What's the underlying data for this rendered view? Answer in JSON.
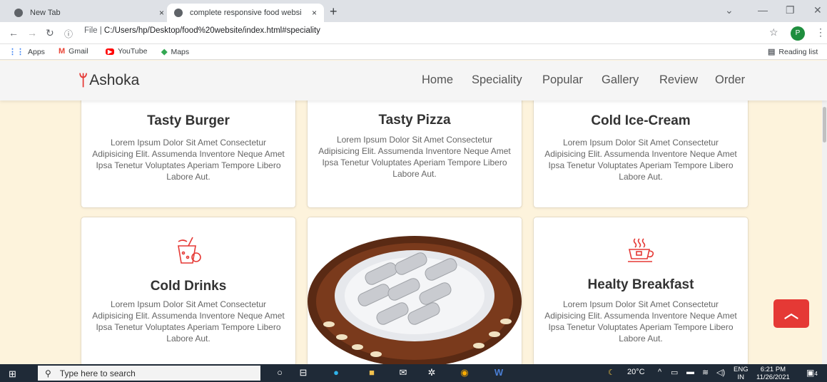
{
  "browser": {
    "tabs": [
      {
        "title": "New Tab",
        "close": "×"
      },
      {
        "title": "complete responsive food websi",
        "close": "×"
      }
    ],
    "new_tab": "+",
    "url_prefix": "File",
    "url": "C:/Users/hp/Desktop/food%20website/index.html#speciality",
    "profile_initial": "P",
    "bookmarks": [
      "Apps",
      "Gmail",
      "YouTube",
      "Maps"
    ],
    "reading_list": "Reading list"
  },
  "site": {
    "logo": "Ashoka",
    "nav": [
      "Home",
      "Speciality",
      "Popular",
      "Gallery",
      "Review",
      "Order"
    ]
  },
  "cards": [
    {
      "title": "Tasty Burger",
      "text": "Lorem Ipsum Dolor Sit Amet Consectetur Adipisicing Elit. Assumenda Inventore Neque Amet Ipsa Tenetur Voluptates Aperiam Tempore Libero Labore Aut."
    },
    {
      "title": "Tasty Pizza",
      "text": "Lorem Ipsum Dolor Sit Amet Consectetur Adipisicing Elit. Assumenda Inventore Neque Amet Ipsa Tenetur Voluptates Aperiam Tempore Libero Labore Aut."
    },
    {
      "title": "Cold Ice-Cream",
      "text": "Lorem Ipsum Dolor Sit Amet Consectetur Adipisicing Elit. Assumenda Inventore Neque Amet Ipsa Tenetur Voluptates Aperiam Tempore Libero Labore Aut."
    },
    {
      "title": "Cold Drinks",
      "text": "Lorem Ipsum Dolor Sit Amet Consectetur Adipisicing Elit. Assumenda Inventore Neque Amet Ipsa Tenetur Voluptates Aperiam Tempore Libero Labore Aut."
    },
    {
      "title": "Healty Breakfast",
      "text": "Lorem Ipsum Dolor Sit Amet Consectetur Adipisicing Elit. Assumenda Inventore Neque Amet Ipsa Tenetur Voluptates Aperiam Tempore Libero Labore Aut."
    }
  ],
  "taskbar": {
    "search_placeholder": "Type here to search",
    "weather": "20°C",
    "lang_top": "ENG",
    "lang_bottom": "IN",
    "time": "6:21 PM",
    "date": "11/26/2021",
    "notifications": "4"
  },
  "colors": {
    "accent": "#e53935",
    "page_bg": "#fdf3dc"
  }
}
